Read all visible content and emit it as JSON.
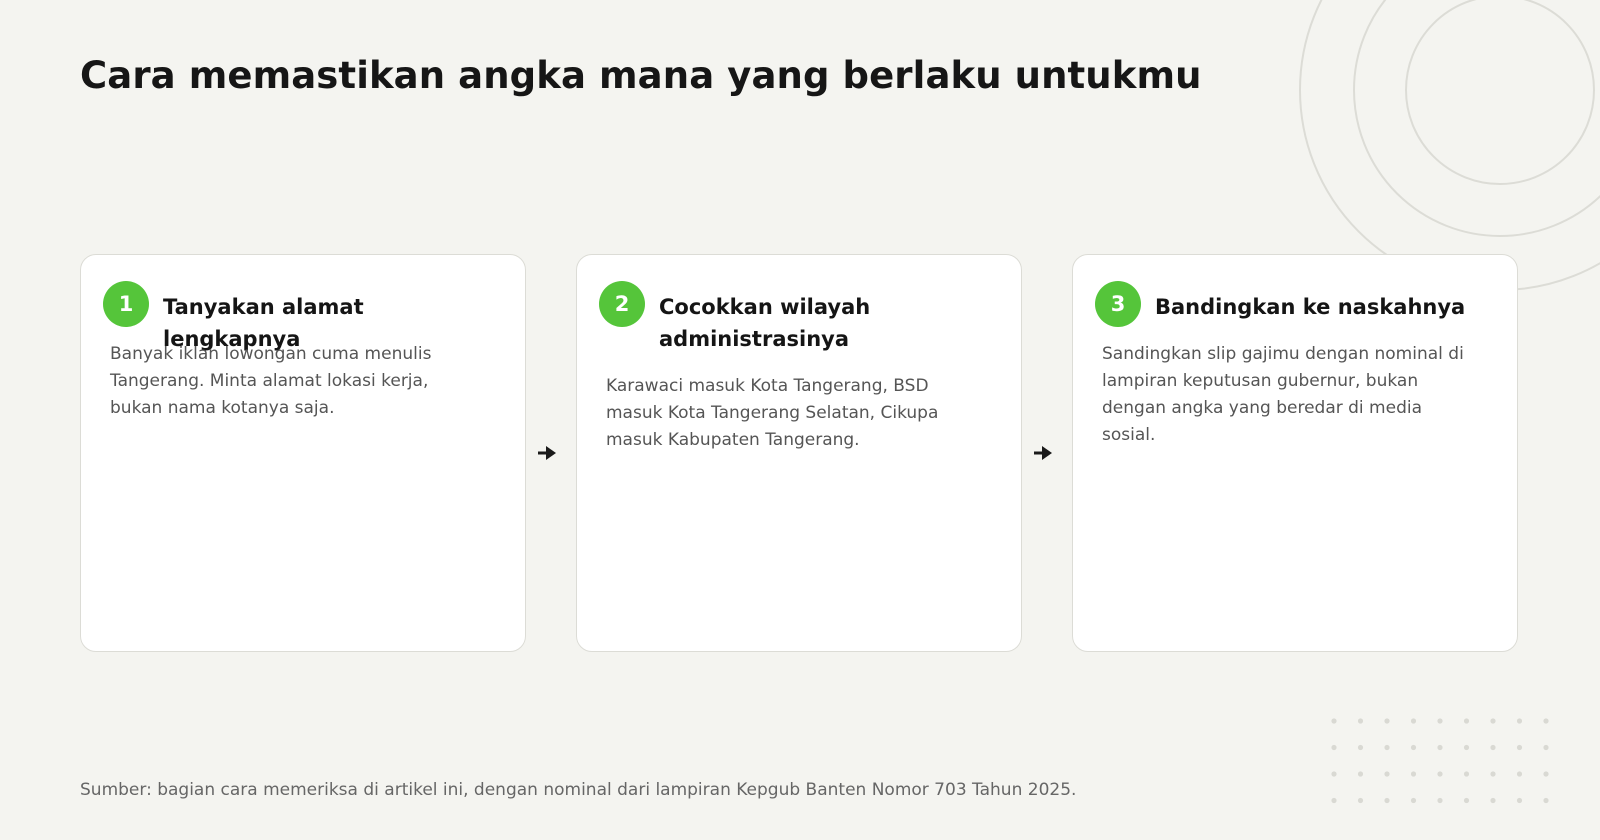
{
  "title": "Cara memastikan angka mana yang berlaku untukmu",
  "steps": [
    {
      "number": "1",
      "title": "Tanyakan alamat lengkapnya",
      "body": "Banyak iklan lowongan cuma menulis Tangerang. Minta alamat lokasi kerja, bukan nama kotanya saja."
    },
    {
      "number": "2",
      "title": "Cocokkan wilayah administrasinya",
      "body": "Karawaci masuk Kota Tangerang, BSD masuk Kota Tangerang Selatan, Cikupa masuk Kabupaten Tangerang."
    },
    {
      "number": "3",
      "title": "Bandingkan ke naskahnya",
      "body": "Sandingkan slip gajimu dengan nominal di lampiran keputusan gubernur, bukan dengan angka yang beredar di media sosial."
    }
  ],
  "source": "Sumber: bagian cara memeriksa di artikel ini, dengan nominal dari lampiran Kepgub Banten Nomor 703 Tahun 2025.",
  "colors": {
    "accent": "#55c53a",
    "background": "#f4f4f0",
    "card": "#ffffff",
    "decor": "#dcdcd6"
  },
  "icons": {
    "connector": "arrow-right-icon"
  }
}
